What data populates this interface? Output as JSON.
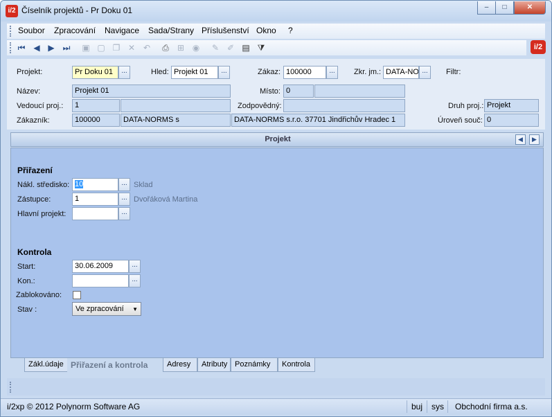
{
  "window": {
    "title": "Číselník projektů - Pr Doku 01",
    "app_icon": "i/2",
    "controls": {
      "minimize": "–",
      "maximize": "□",
      "close": "✕"
    }
  },
  "menu": [
    "Soubor",
    "Zpracování",
    "Navigace",
    "Sada/Strany",
    "Příslušenství",
    "Okno",
    "?"
  ],
  "toolbar": {
    "icons": [
      "first-record-icon",
      "prev-record-icon",
      "next-record-icon",
      "last-record-icon",
      "save-icon",
      "new-icon",
      "copy-icon",
      "delete-icon",
      "undo-icon",
      "print-icon",
      "tree-icon",
      "refresh-icon",
      "edit-icon",
      "pen-icon",
      "table-icon",
      "filter-icon"
    ]
  },
  "header": {
    "projekt": {
      "label": "Projekt:",
      "value": "Pr Doku 01"
    },
    "hled": {
      "label": "Hled:",
      "value": "Projekt 01"
    },
    "zakaz": {
      "label": "Zákaz:",
      "value": "100000"
    },
    "zkr_jm": {
      "label": "Zkr. jm.:",
      "value": "DATA-NO"
    },
    "filtr": {
      "label": "Filtr:"
    },
    "nazev": {
      "label": "Název:",
      "value": "Projekt 01"
    },
    "misto": {
      "label": "Místo:",
      "value": "0",
      "value2": ""
    },
    "vedouci": {
      "label": "Vedoucí proj.:",
      "value": "1",
      "value2": ""
    },
    "zodpovedny": {
      "label": "Zodpovědný:",
      "value": ""
    },
    "druh": {
      "label": "Druh proj.:",
      "value": "Projekt"
    },
    "zakaznik": {
      "label": "Zákazník:",
      "code": "100000",
      "name": "DATA-NORMS s",
      "address": "DATA-NORMS s.r.o. 37701 Jindřichův Hradec 1"
    },
    "uroven": {
      "label": "Úroveň souč:",
      "value": "0"
    }
  },
  "section": {
    "title": "Projekt"
  },
  "prirazeni": {
    "title": "Přiřazení",
    "nakl": {
      "label": "Nákl. středisko:",
      "value": "10",
      "hint": "Sklad"
    },
    "zastupce": {
      "label": "Zástupce:",
      "value": "1",
      "hint": "Dvořáková Martina"
    },
    "hlavni": {
      "label": "Hlavní projekt:",
      "value": ""
    }
  },
  "kontrola": {
    "title": "Kontrola",
    "start": {
      "label": "Start:",
      "value": "30.06.2009"
    },
    "kon": {
      "label": "Kon.:",
      "value": ""
    },
    "zablokovano": {
      "label": "Zablokováno:",
      "checked": false
    },
    "stav": {
      "label": "Stav  :",
      "value": "Ve zpracování"
    }
  },
  "tabs": [
    "Zákl.údaje",
    "Přiřazení a kontrola",
    "Adresy",
    "Atributy",
    "Poznámky",
    "Kontrola"
  ],
  "status": {
    "copyright": "i/2xp © 2012 Polynorm Software AG",
    "user": "buj",
    "db": "sys",
    "company": "Obchodní firma a.s."
  },
  "ellipsis": "..."
}
